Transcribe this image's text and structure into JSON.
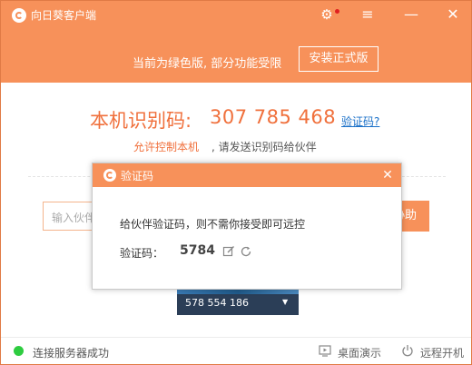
{
  "app": {
    "title": "向日葵客户端",
    "gear_glyph": "⚙",
    "menu_glyph": "≡",
    "min_glyph": "—",
    "close_glyph": "✕"
  },
  "banner": {
    "text": "当前为绿色版, 部分功能受限",
    "install_button": "安装正式版"
  },
  "main": {
    "id_label": "本机识别码:",
    "id_value": "307 785 468",
    "verify_link": "验证码?",
    "allow_link": "允许控制本机",
    "allow_rest": ", 请发送识别码给伙伴",
    "partner_placeholder": "输入伙伴",
    "assist_button": "协助"
  },
  "dialog": {
    "title": "验证码",
    "close_glyph": "✕",
    "message": "给伙伴验证码，则不需你接受即可远控",
    "code_label": "验证码：",
    "code_value": "5784"
  },
  "device": {
    "id": "578 554 186",
    "dropdown_glyph": "▼"
  },
  "status": {
    "connection_text": "连接服务器成功",
    "desktop_demo": "桌面演示",
    "remote_boot": "远程开机",
    "connected_color": "#2ecc40"
  },
  "theme": {
    "accent": "#f7915a",
    "accent_text": "#f0703c",
    "link": "#1a70c8"
  }
}
